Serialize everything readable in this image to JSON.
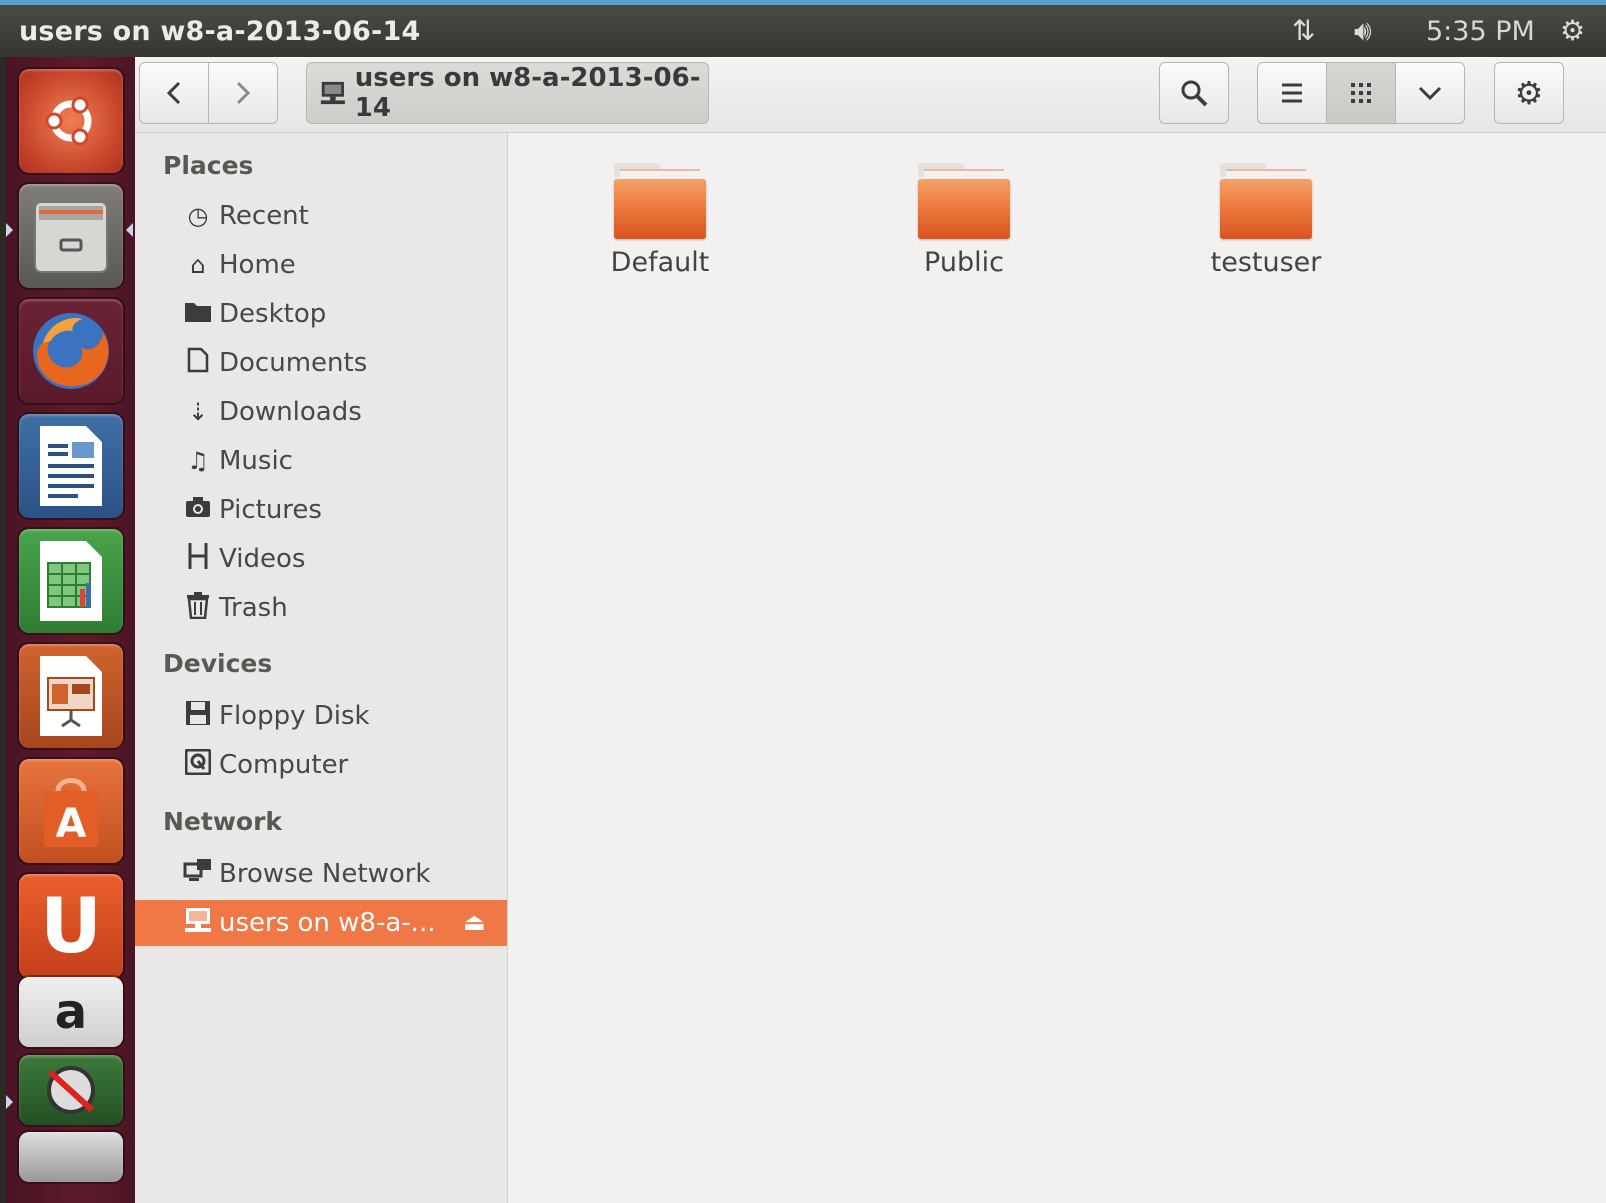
{
  "panel": {
    "window_title": "users on w8-a-2013-06-14",
    "clock": "5:35 PM",
    "network_icon": "network-updown-icon",
    "sound_icon": "volume-icon",
    "power_icon": "session-gear-icon"
  },
  "launcher": {
    "items": [
      "dash-home",
      "files",
      "firefox",
      "libreoffice-writer",
      "libreoffice-calc",
      "libreoffice-impress",
      "ubuntu-software-center",
      "ubuntu-one",
      "amazon",
      "app-stack"
    ],
    "amazon_glyph": "a",
    "ubuntuone_glyph": "U",
    "software_glyph": "A"
  },
  "toolbar": {
    "path_label": "users on w8-a-2013-06-14"
  },
  "sidebar": {
    "places_header": "Places",
    "places": [
      {
        "label": "Recent",
        "icon": "clock-icon"
      },
      {
        "label": "Home",
        "icon": "home-icon"
      },
      {
        "label": "Desktop",
        "icon": "folder-icon"
      },
      {
        "label": "Documents",
        "icon": "document-icon"
      },
      {
        "label": "Downloads",
        "icon": "download-icon"
      },
      {
        "label": "Music",
        "icon": "music-icon"
      },
      {
        "label": "Pictures",
        "icon": "camera-icon"
      },
      {
        "label": "Videos",
        "icon": "film-icon"
      },
      {
        "label": "Trash",
        "icon": "trash-icon"
      }
    ],
    "devices_header": "Devices",
    "devices": [
      {
        "label": "Floppy Disk",
        "icon": "floppy-icon"
      },
      {
        "label": "Computer",
        "icon": "harddisk-icon"
      }
    ],
    "network_header": "Network",
    "network": [
      {
        "label": "Browse Network",
        "icon": "network-icon"
      },
      {
        "label": "users on w8-a-...",
        "icon": "network-share-icon",
        "active": true
      }
    ]
  },
  "content": {
    "folders": [
      "Default",
      "Public",
      "testuser"
    ]
  },
  "colors": {
    "accent": "#f07746",
    "launcher_bg": "#5d1b2b",
    "folder_orange": "#ee7b3e"
  }
}
